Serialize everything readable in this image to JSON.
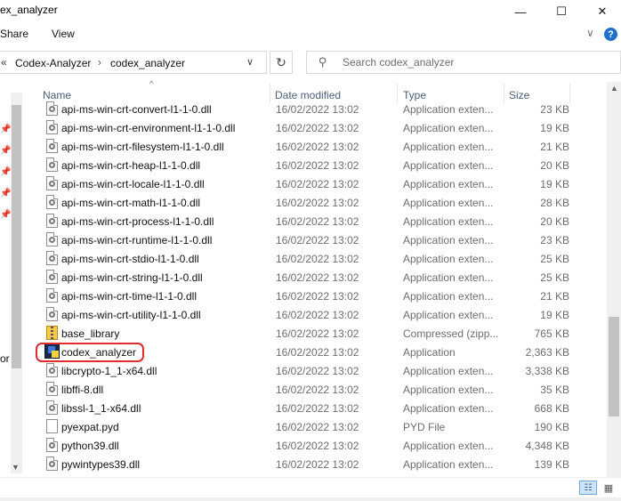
{
  "window": {
    "title": "ex_analyzer",
    "minimize_glyph": "—",
    "maximize_glyph": "☐",
    "close_glyph": "✕"
  },
  "ribbon": {
    "tabs": [
      "Share",
      "View"
    ],
    "expand_glyph": "∨",
    "help_glyph": "?"
  },
  "address": {
    "overflow_glyph": "«",
    "crumbs": [
      "Codex-Analyzer",
      "codex_analyzer"
    ],
    "separator": "›",
    "dropdown_glyph": "∨",
    "refresh_glyph": "↻"
  },
  "search": {
    "placeholder": "Search codex_analyzer",
    "icon": "search-icon"
  },
  "nav": {
    "clipped_text": "or"
  },
  "columns": {
    "name": "Name",
    "date": "Date modified",
    "type": "Type",
    "size": "Size"
  },
  "files": [
    {
      "name": "api-ms-win-crt-convert-l1-1-0.dll",
      "date": "16/02/2022 13:02",
      "type": "Application exten...",
      "size": "23 KB",
      "icon": "dll"
    },
    {
      "name": "api-ms-win-crt-environment-l1-1-0.dll",
      "date": "16/02/2022 13:02",
      "type": "Application exten...",
      "size": "19 KB",
      "icon": "dll"
    },
    {
      "name": "api-ms-win-crt-filesystem-l1-1-0.dll",
      "date": "16/02/2022 13:02",
      "type": "Application exten...",
      "size": "21 KB",
      "icon": "dll"
    },
    {
      "name": "api-ms-win-crt-heap-l1-1-0.dll",
      "date": "16/02/2022 13:02",
      "type": "Application exten...",
      "size": "20 KB",
      "icon": "dll"
    },
    {
      "name": "api-ms-win-crt-locale-l1-1-0.dll",
      "date": "16/02/2022 13:02",
      "type": "Application exten...",
      "size": "19 KB",
      "icon": "dll"
    },
    {
      "name": "api-ms-win-crt-math-l1-1-0.dll",
      "date": "16/02/2022 13:02",
      "type": "Application exten...",
      "size": "28 KB",
      "icon": "dll"
    },
    {
      "name": "api-ms-win-crt-process-l1-1-0.dll",
      "date": "16/02/2022 13:02",
      "type": "Application exten...",
      "size": "20 KB",
      "icon": "dll"
    },
    {
      "name": "api-ms-win-crt-runtime-l1-1-0.dll",
      "date": "16/02/2022 13:02",
      "type": "Application exten...",
      "size": "23 KB",
      "icon": "dll"
    },
    {
      "name": "api-ms-win-crt-stdio-l1-1-0.dll",
      "date": "16/02/2022 13:02",
      "type": "Application exten...",
      "size": "25 KB",
      "icon": "dll"
    },
    {
      "name": "api-ms-win-crt-string-l1-1-0.dll",
      "date": "16/02/2022 13:02",
      "type": "Application exten...",
      "size": "25 KB",
      "icon": "dll"
    },
    {
      "name": "api-ms-win-crt-time-l1-1-0.dll",
      "date": "16/02/2022 13:02",
      "type": "Application exten...",
      "size": "21 KB",
      "icon": "dll"
    },
    {
      "name": "api-ms-win-crt-utility-l1-1-0.dll",
      "date": "16/02/2022 13:02",
      "type": "Application exten...",
      "size": "19 KB",
      "icon": "dll"
    },
    {
      "name": "base_library",
      "date": "16/02/2022 13:02",
      "type": "Compressed (zipp...",
      "size": "765 KB",
      "icon": "zip"
    },
    {
      "name": "codex_analyzer",
      "date": "16/02/2022 13:02",
      "type": "Application",
      "size": "2,363 KB",
      "icon": "app"
    },
    {
      "name": "libcrypto-1_1-x64.dll",
      "date": "16/02/2022 13:02",
      "type": "Application exten...",
      "size": "3,338 KB",
      "icon": "dll"
    },
    {
      "name": "libffi-8.dll",
      "date": "16/02/2022 13:02",
      "type": "Application exten...",
      "size": "35 KB",
      "icon": "dll"
    },
    {
      "name": "libssl-1_1-x64.dll",
      "date": "16/02/2022 13:02",
      "type": "Application exten...",
      "size": "668 KB",
      "icon": "dll"
    },
    {
      "name": "pyexpat.pyd",
      "date": "16/02/2022 13:02",
      "type": "PYD File",
      "size": "190 KB",
      "icon": "plain"
    },
    {
      "name": "python39.dll",
      "date": "16/02/2022 13:02",
      "type": "Application exten...",
      "size": "4,348 KB",
      "icon": "dll"
    },
    {
      "name": "pywintypes39.dll",
      "date": "16/02/2022 13:02",
      "type": "Application exten...",
      "size": "139 KB",
      "icon": "dll"
    }
  ],
  "highlighted_file": "codex_analyzer",
  "colors": {
    "highlight_ring": "#e22b2b",
    "header_text": "#4c607a",
    "accent": "#1e70c9"
  }
}
